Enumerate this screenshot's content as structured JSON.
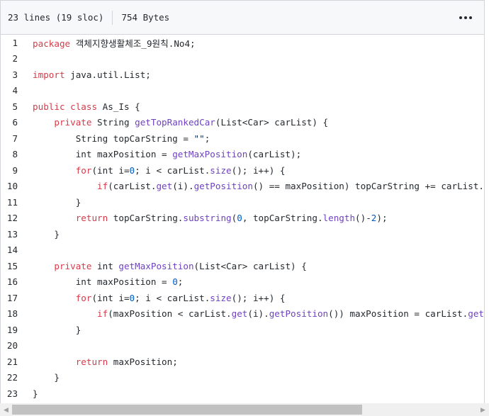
{
  "file_header": {
    "lines_info": "23 lines (19 sloc)",
    "size": "754 Bytes",
    "more_icon": "kebab-horizontal-icon"
  },
  "code_lines": [
    [
      {
        "t": "package",
        "c": "kw"
      },
      {
        "t": " 객체지향생활체조_9원칙.No4;",
        "c": ""
      }
    ],
    [],
    [
      {
        "t": "import",
        "c": "kw"
      },
      {
        "t": " java.util.List;",
        "c": ""
      }
    ],
    [],
    [
      {
        "t": "public",
        "c": "kw"
      },
      {
        "t": " ",
        "c": ""
      },
      {
        "t": "class",
        "c": "kw"
      },
      {
        "t": " As_Is {",
        "c": ""
      }
    ],
    [
      {
        "t": "    ",
        "c": ""
      },
      {
        "t": "private",
        "c": "kw"
      },
      {
        "t": " String ",
        "c": ""
      },
      {
        "t": "getTopRankedCar",
        "c": "fn"
      },
      {
        "t": "(List<Car> carList) {",
        "c": ""
      }
    ],
    [
      {
        "t": "        String topCarString = ",
        "c": ""
      },
      {
        "t": "\"\"",
        "c": "str"
      },
      {
        "t": ";",
        "c": ""
      }
    ],
    [
      {
        "t": "        int maxPosition = ",
        "c": ""
      },
      {
        "t": "getMaxPosition",
        "c": "fn"
      },
      {
        "t": "(carList);",
        "c": ""
      }
    ],
    [
      {
        "t": "        ",
        "c": ""
      },
      {
        "t": "for",
        "c": "kw"
      },
      {
        "t": "(int i=",
        "c": ""
      },
      {
        "t": "0",
        "c": "num"
      },
      {
        "t": "; i < carList.",
        "c": ""
      },
      {
        "t": "size",
        "c": "fn"
      },
      {
        "t": "(); i++) {",
        "c": ""
      }
    ],
    [
      {
        "t": "            ",
        "c": ""
      },
      {
        "t": "if",
        "c": "kw"
      },
      {
        "t": "(carList.",
        "c": ""
      },
      {
        "t": "get",
        "c": "fn"
      },
      {
        "t": "(i).",
        "c": ""
      },
      {
        "t": "getPosition",
        "c": "fn"
      },
      {
        "t": "() == maxPosition) topCarString += carList.",
        "c": ""
      }
    ],
    [
      {
        "t": "        }",
        "c": ""
      }
    ],
    [
      {
        "t": "        ",
        "c": ""
      },
      {
        "t": "return",
        "c": "kw"
      },
      {
        "t": " topCarString.",
        "c": ""
      },
      {
        "t": "substring",
        "c": "fn"
      },
      {
        "t": "(",
        "c": ""
      },
      {
        "t": "0",
        "c": "num"
      },
      {
        "t": ", topCarString.",
        "c": ""
      },
      {
        "t": "length",
        "c": "fn"
      },
      {
        "t": "()-",
        "c": ""
      },
      {
        "t": "2",
        "c": "num"
      },
      {
        "t": ");",
        "c": ""
      }
    ],
    [
      {
        "t": "    }",
        "c": ""
      }
    ],
    [],
    [
      {
        "t": "    ",
        "c": ""
      },
      {
        "t": "private",
        "c": "kw"
      },
      {
        "t": " int ",
        "c": ""
      },
      {
        "t": "getMaxPosition",
        "c": "fn"
      },
      {
        "t": "(List<Car> carList) {",
        "c": ""
      }
    ],
    [
      {
        "t": "        int maxPosition = ",
        "c": ""
      },
      {
        "t": "0",
        "c": "num"
      },
      {
        "t": ";",
        "c": ""
      }
    ],
    [
      {
        "t": "        ",
        "c": ""
      },
      {
        "t": "for",
        "c": "kw"
      },
      {
        "t": "(int i=",
        "c": ""
      },
      {
        "t": "0",
        "c": "num"
      },
      {
        "t": "; i < carList.",
        "c": ""
      },
      {
        "t": "size",
        "c": "fn"
      },
      {
        "t": "(); i++) {",
        "c": ""
      }
    ],
    [
      {
        "t": "            ",
        "c": ""
      },
      {
        "t": "if",
        "c": "kw"
      },
      {
        "t": "(maxPosition < carList.",
        "c": ""
      },
      {
        "t": "get",
        "c": "fn"
      },
      {
        "t": "(i).",
        "c": ""
      },
      {
        "t": "getPosition",
        "c": "fn"
      },
      {
        "t": "()) maxPosition = carList.",
        "c": ""
      },
      {
        "t": "get",
        "c": "fn"
      }
    ],
    [
      {
        "t": "        }",
        "c": ""
      }
    ],
    [],
    [
      {
        "t": "        ",
        "c": ""
      },
      {
        "t": "return",
        "c": "kw"
      },
      {
        "t": " maxPosition;",
        "c": ""
      }
    ],
    [
      {
        "t": "    }",
        "c": ""
      }
    ],
    [
      {
        "t": "}",
        "c": ""
      }
    ]
  ],
  "colors": {
    "keyword": "#d73a49",
    "function": "#6f42c1",
    "number": "#005cc5",
    "string": "#032f62",
    "header_bg": "#f6f8fa"
  },
  "scrollbar": {
    "left_arrow_icon": "scroll-left-icon",
    "right_arrow_icon": "scroll-right-icon"
  }
}
